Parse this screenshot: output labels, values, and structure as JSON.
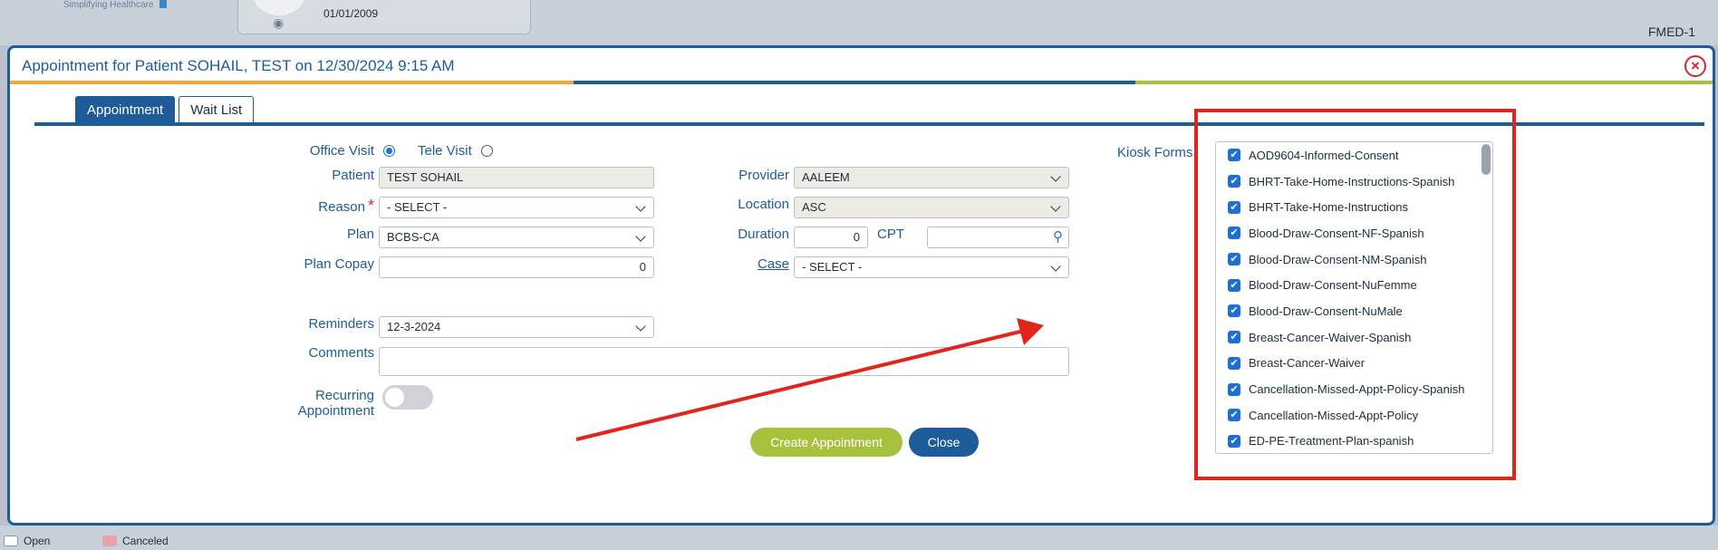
{
  "background": {
    "logo_tagline": "Simplifying Healthcare",
    "dob": "01/01/2009",
    "workstation": "FMED-1",
    "legend": [
      {
        "label": "Open",
        "color": "#ffffff"
      },
      {
        "label": "Canceled",
        "color": "#e9a3a8"
      }
    ]
  },
  "dialog": {
    "title": "Appointment for Patient SOHAIL, TEST on 12/30/2024 9:15 AM",
    "tabs": [
      {
        "label": "Appointment",
        "active": true
      },
      {
        "label": "Wait List",
        "active": false
      }
    ],
    "visit_type": {
      "office_label": "Office Visit",
      "tele_label": "Tele Visit",
      "selected": "Office Visit"
    },
    "form": {
      "patient_label": "Patient",
      "patient_value": "TEST SOHAIL",
      "reason_label": "Reason",
      "reason_value": "- SELECT -",
      "required_mark": "*",
      "plan_label": "Plan",
      "plan_value": "BCBS-CA",
      "copay_label": "Plan Copay",
      "copay_value": "0",
      "provider_label": "Provider",
      "provider_value": "AALEEM",
      "location_label": "Location",
      "location_value": "ASC",
      "duration_label": "Duration",
      "duration_value": "0",
      "cpt_label": "CPT",
      "cpt_value": "",
      "case_label": "Case",
      "case_value": "- SELECT -",
      "reminders_label": "Reminders",
      "reminders_value": "12-3-2024",
      "comments_label": "Comments",
      "comments_value": "",
      "recurring_label_1": "Recurring",
      "recurring_label_2": "Appointment",
      "recurring_on": false
    },
    "buttons": {
      "create": "Create Appointment",
      "close": "Close"
    },
    "kiosk": {
      "label": "Kiosk Forms",
      "items": [
        "AOD9604-Informed-Consent",
        "BHRT-Take-Home-Instructions-Spanish",
        "BHRT-Take-Home-Instructions",
        "Blood-Draw-Consent-NF-Spanish",
        "Blood-Draw-Consent-NM-Spanish",
        "Blood-Draw-Consent-NuFemme",
        "Blood-Draw-Consent-NuMale",
        "Breast-Cancer-Waiver-Spanish",
        "Breast-Cancer-Waiver",
        "Cancellation-Missed-Appt-Policy-Spanish",
        "Cancellation-Missed-Appt-Policy",
        "ED-PE-Treatment-Plan-spanish"
      ]
    }
  },
  "colors": {
    "primary": "#1d5c98",
    "accent_green": "#a7c13c",
    "accent_orange": "#f0a830",
    "annotation_red": "#e3241c"
  }
}
